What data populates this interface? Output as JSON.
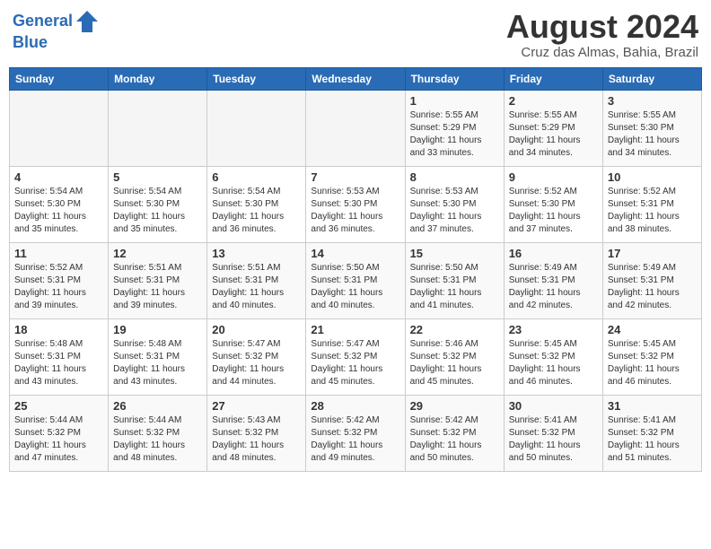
{
  "header": {
    "logo_line1": "General",
    "logo_line2": "Blue",
    "month_year": "August 2024",
    "location": "Cruz das Almas, Bahia, Brazil"
  },
  "weekdays": [
    "Sunday",
    "Monday",
    "Tuesday",
    "Wednesday",
    "Thursday",
    "Friday",
    "Saturday"
  ],
  "weeks": [
    [
      {
        "day": "",
        "info": ""
      },
      {
        "day": "",
        "info": ""
      },
      {
        "day": "",
        "info": ""
      },
      {
        "day": "",
        "info": ""
      },
      {
        "day": "1",
        "info": "Sunrise: 5:55 AM\nSunset: 5:29 PM\nDaylight: 11 hours\nand 33 minutes."
      },
      {
        "day": "2",
        "info": "Sunrise: 5:55 AM\nSunset: 5:29 PM\nDaylight: 11 hours\nand 34 minutes."
      },
      {
        "day": "3",
        "info": "Sunrise: 5:55 AM\nSunset: 5:30 PM\nDaylight: 11 hours\nand 34 minutes."
      }
    ],
    [
      {
        "day": "4",
        "info": "Sunrise: 5:54 AM\nSunset: 5:30 PM\nDaylight: 11 hours\nand 35 minutes."
      },
      {
        "day": "5",
        "info": "Sunrise: 5:54 AM\nSunset: 5:30 PM\nDaylight: 11 hours\nand 35 minutes."
      },
      {
        "day": "6",
        "info": "Sunrise: 5:54 AM\nSunset: 5:30 PM\nDaylight: 11 hours\nand 36 minutes."
      },
      {
        "day": "7",
        "info": "Sunrise: 5:53 AM\nSunset: 5:30 PM\nDaylight: 11 hours\nand 36 minutes."
      },
      {
        "day": "8",
        "info": "Sunrise: 5:53 AM\nSunset: 5:30 PM\nDaylight: 11 hours\nand 37 minutes."
      },
      {
        "day": "9",
        "info": "Sunrise: 5:52 AM\nSunset: 5:30 PM\nDaylight: 11 hours\nand 37 minutes."
      },
      {
        "day": "10",
        "info": "Sunrise: 5:52 AM\nSunset: 5:31 PM\nDaylight: 11 hours\nand 38 minutes."
      }
    ],
    [
      {
        "day": "11",
        "info": "Sunrise: 5:52 AM\nSunset: 5:31 PM\nDaylight: 11 hours\nand 39 minutes."
      },
      {
        "day": "12",
        "info": "Sunrise: 5:51 AM\nSunset: 5:31 PM\nDaylight: 11 hours\nand 39 minutes."
      },
      {
        "day": "13",
        "info": "Sunrise: 5:51 AM\nSunset: 5:31 PM\nDaylight: 11 hours\nand 40 minutes."
      },
      {
        "day": "14",
        "info": "Sunrise: 5:50 AM\nSunset: 5:31 PM\nDaylight: 11 hours\nand 40 minutes."
      },
      {
        "day": "15",
        "info": "Sunrise: 5:50 AM\nSunset: 5:31 PM\nDaylight: 11 hours\nand 41 minutes."
      },
      {
        "day": "16",
        "info": "Sunrise: 5:49 AM\nSunset: 5:31 PM\nDaylight: 11 hours\nand 42 minutes."
      },
      {
        "day": "17",
        "info": "Sunrise: 5:49 AM\nSunset: 5:31 PM\nDaylight: 11 hours\nand 42 minutes."
      }
    ],
    [
      {
        "day": "18",
        "info": "Sunrise: 5:48 AM\nSunset: 5:31 PM\nDaylight: 11 hours\nand 43 minutes."
      },
      {
        "day": "19",
        "info": "Sunrise: 5:48 AM\nSunset: 5:31 PM\nDaylight: 11 hours\nand 43 minutes."
      },
      {
        "day": "20",
        "info": "Sunrise: 5:47 AM\nSunset: 5:32 PM\nDaylight: 11 hours\nand 44 minutes."
      },
      {
        "day": "21",
        "info": "Sunrise: 5:47 AM\nSunset: 5:32 PM\nDaylight: 11 hours\nand 45 minutes."
      },
      {
        "day": "22",
        "info": "Sunrise: 5:46 AM\nSunset: 5:32 PM\nDaylight: 11 hours\nand 45 minutes."
      },
      {
        "day": "23",
        "info": "Sunrise: 5:45 AM\nSunset: 5:32 PM\nDaylight: 11 hours\nand 46 minutes."
      },
      {
        "day": "24",
        "info": "Sunrise: 5:45 AM\nSunset: 5:32 PM\nDaylight: 11 hours\nand 46 minutes."
      }
    ],
    [
      {
        "day": "25",
        "info": "Sunrise: 5:44 AM\nSunset: 5:32 PM\nDaylight: 11 hours\nand 47 minutes."
      },
      {
        "day": "26",
        "info": "Sunrise: 5:44 AM\nSunset: 5:32 PM\nDaylight: 11 hours\nand 48 minutes."
      },
      {
        "day": "27",
        "info": "Sunrise: 5:43 AM\nSunset: 5:32 PM\nDaylight: 11 hours\nand 48 minutes."
      },
      {
        "day": "28",
        "info": "Sunrise: 5:42 AM\nSunset: 5:32 PM\nDaylight: 11 hours\nand 49 minutes."
      },
      {
        "day": "29",
        "info": "Sunrise: 5:42 AM\nSunset: 5:32 PM\nDaylight: 11 hours\nand 50 minutes."
      },
      {
        "day": "30",
        "info": "Sunrise: 5:41 AM\nSunset: 5:32 PM\nDaylight: 11 hours\nand 50 minutes."
      },
      {
        "day": "31",
        "info": "Sunrise: 5:41 AM\nSunset: 5:32 PM\nDaylight: 11 hours\nand 51 minutes."
      }
    ]
  ]
}
